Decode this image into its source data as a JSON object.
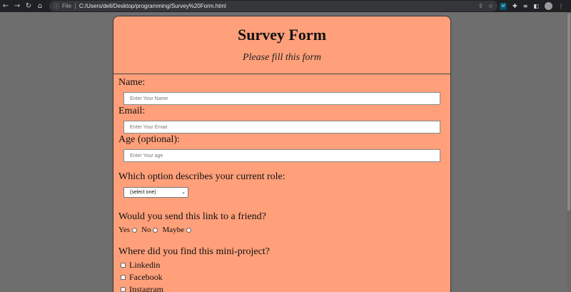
{
  "browser": {
    "file_label": "File",
    "url": "C:/Users/dell/Desktop/programming/Survey%20Form.html",
    "ext_label": "M"
  },
  "form": {
    "title": "Survey Form",
    "subtitle": "Please fill this form",
    "name_label": "Name:",
    "name_placeholder": "Enter Your Name",
    "email_label": "Email:",
    "email_placeholder": "Enter Your Email",
    "age_label": "Age (optional):",
    "age_placeholder": "Enter Your age",
    "role_question": "Which option describes your current role:",
    "role_select_value": "(select one)",
    "friend_question": "Would you send this link to a friend?",
    "friend_options": [
      "Yes",
      "No",
      "Maybe"
    ],
    "where_question": "Where did you find this mini-project?",
    "where_options": [
      "Linkedin",
      "Facebook",
      "Instagram"
    ]
  },
  "colors": {
    "card_background": "#ffa07a",
    "page_background": "#6e6e6e"
  }
}
